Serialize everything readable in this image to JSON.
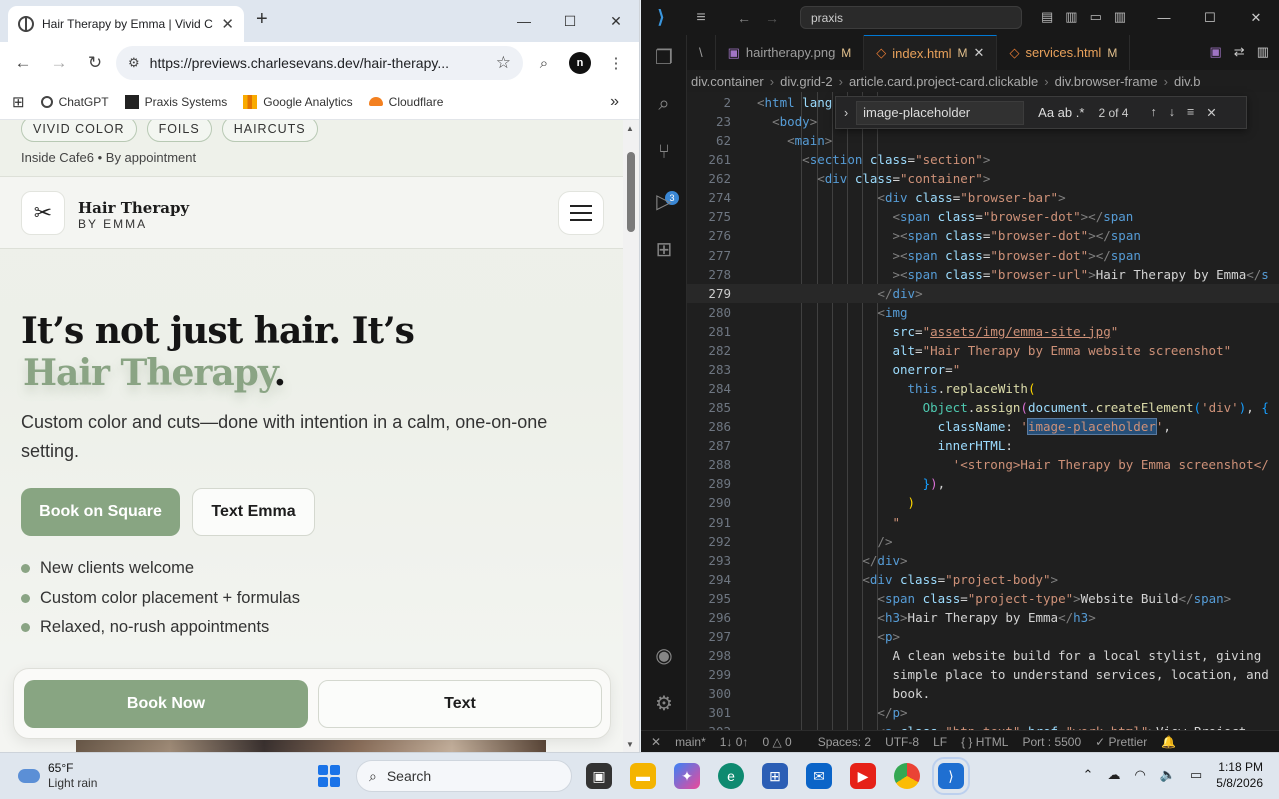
{
  "chrome": {
    "tab_title": "Hair Therapy by Emma | Vivid C",
    "url": "https://previews.charlesevans.dev/hair-therapy...",
    "bookmarks": [
      "ChatGPT",
      "Praxis Systems",
      "Google Analytics",
      "Cloudflare"
    ],
    "profile_initial": "n"
  },
  "site": {
    "chips": [
      "VIVID COLOR",
      "FOILS",
      "HAIRCUTS"
    ],
    "sub_info": "Inside Cafe6 • By appointment",
    "brand_name": "Hair Therapy",
    "brand_sub": "BY EMMA",
    "hero_line1": "It’s not just hair. It’s",
    "hero_line2": "Hair Therapy",
    "hero_dot": ".",
    "hero_desc": "Custom color and cuts—done with intention in a calm, one-on-one setting.",
    "btn_primary": "Book on Square",
    "btn_secondary": "Text Emma",
    "features": [
      "New clients welcome",
      "Custom color placement + formulas",
      "Relaxed, no-rush appointments"
    ],
    "sticky_book": "Book Now",
    "sticky_text": "Text"
  },
  "vscode": {
    "search": "praxis",
    "tabs": [
      {
        "label": "\\",
        "mod": ""
      },
      {
        "label": "hairtherapy.png",
        "mod": "M"
      },
      {
        "label": "index.html",
        "mod": "M"
      },
      {
        "label": "services.html",
        "mod": "M"
      }
    ],
    "breadcrumbs": [
      "div.container",
      "div.grid-2",
      "article.card.project-card.clickable",
      "div.browser-frame",
      "div.b"
    ],
    "find": {
      "query": "image-placeholder",
      "count": "2 of 4"
    },
    "status": {
      "branch": "main*",
      "sync": "1↓ 0↑",
      "problems": "0 △ 0",
      "spaces": "Spaces: 2",
      "encoding": "UTF-8",
      "eol": "LF",
      "language": "{ } HTML",
      "port": "Port : 5500",
      "prettier": "✓ Prettier"
    },
    "lines": [
      {
        "n": "2",
        "html": "<span class='t-brk'>&lt;</span><span class='t-tag'>html</span> <span class='t-attr'>lang</span>"
      },
      {
        "n": "23",
        "html": "  <span class='t-brk'>&lt;</span><span class='t-tag'>body</span><span class='t-brk'>&gt;</span>"
      },
      {
        "n": "62",
        "html": "    <span class='t-brk'>&lt;</span><span class='t-tag'>main</span><span class='t-brk'>&gt;</span>"
      },
      {
        "n": "261",
        "html": "      <span class='t-brk'>&lt;</span><span class='t-tag'>section</span> <span class='t-attr'>class</span><span class='t-txt'>=</span><span class='t-str'>\"section\"</span><span class='t-brk'>&gt;</span>"
      },
      {
        "n": "262",
        "html": "        <span class='t-brk'>&lt;</span><span class='t-tag'>div</span> <span class='t-attr'>class</span><span class='t-txt'>=</span><span class='t-str'>\"container\"</span><span class='t-brk'>&gt;</span>"
      },
      {
        "n": "274",
        "html": "                <span class='t-brk'>&lt;</span><span class='t-tag'>div</span> <span class='t-attr'>class</span><span class='t-txt'>=</span><span class='t-str'>\"browser-bar\"</span><span class='t-brk'>&gt;</span>"
      },
      {
        "n": "275",
        "html": "                  <span class='t-brk'>&lt;</span><span class='t-tag'>span</span> <span class='t-attr'>class</span><span class='t-txt'>=</span><span class='t-str'>\"browser-dot\"</span><span class='t-brk'>&gt;&lt;/</span><span class='t-tag'>span</span>"
      },
      {
        "n": "276",
        "html": "                  <span class='t-brk'>&gt;&lt;</span><span class='t-tag'>span</span> <span class='t-attr'>class</span><span class='t-txt'>=</span><span class='t-str'>\"browser-dot\"</span><span class='t-brk'>&gt;&lt;/</span><span class='t-tag'>span</span>"
      },
      {
        "n": "277",
        "html": "                  <span class='t-brk'>&gt;&lt;</span><span class='t-tag'>span</span> <span class='t-attr'>class</span><span class='t-txt'>=</span><span class='t-str'>\"browser-dot\"</span><span class='t-brk'>&gt;&lt;/</span><span class='t-tag'>span</span>"
      },
      {
        "n": "278",
        "html": "                  <span class='t-brk'>&gt;&lt;</span><span class='t-tag'>span</span> <span class='t-attr'>class</span><span class='t-txt'>=</span><span class='t-str'>\"browser-url\"</span><span class='t-brk'>&gt;</span><span class='t-txt'>Hair Therapy by Emma</span><span class='t-brk'>&lt;/</span><span class='t-tag'>s</span>"
      },
      {
        "n": "279",
        "html": "                <span class='t-brk'>&lt;/</span><span class='t-tag'>div</span><span class='t-brk'>&gt;</span>",
        "current": true
      },
      {
        "n": "280",
        "html": "                <span class='t-brk'>&lt;</span><span class='t-tag'>img</span>"
      },
      {
        "n": "281",
        "html": "                  <span class='t-attr'>src</span><span class='t-txt'>=</span><span class='t-str'>\"<span class='t-link'>assets/img/emma-site.jpg</span>\"</span>"
      },
      {
        "n": "282",
        "html": "                  <span class='t-attr'>alt</span><span class='t-txt'>=</span><span class='t-str'>\"Hair Therapy by Emma website screenshot\"</span>"
      },
      {
        "n": "283",
        "html": "                  <span class='t-attr'>onerror</span><span class='t-txt'>=</span><span class='t-str'>\"</span>"
      },
      {
        "n": "284",
        "html": "                    <span class='t-kw'>this</span><span class='t-txt'>.</span><span class='t-fn'>replaceWith</span><span class='t-p1'>(</span>"
      },
      {
        "n": "285",
        "html": "                      <span class='t-ent'>Object</span><span class='t-txt'>.</span><span class='t-fn'>assign</span><span class='t-p2'>(</span><span class='t-attr'>document</span><span class='t-txt'>.</span><span class='t-fn'>createElement</span><span class='t-p3'>(</span><span class='t-str'>'div'</span><span class='t-p3'>)</span><span class='t-txt'>, </span><span class='t-p3'>{</span>"
      },
      {
        "n": "286",
        "html": "                        <span class='t-attr'>className</span><span class='t-txt'>: </span><span class='t-str'>'<span class='t-hl'>image-placeholder</span>'</span><span class='t-txt'>,</span>"
      },
      {
        "n": "287",
        "html": "                        <span class='t-attr'>innerHTML</span><span class='t-txt'>:</span>"
      },
      {
        "n": "288",
        "html": "                          <span class='t-str'>'&lt;strong&gt;Hair Therapy by Emma screenshot&lt;/</span>"
      },
      {
        "n": "289",
        "html": "                      <span class='t-p3'>}</span><span class='t-p2'>)</span><span class='t-txt'>,</span>"
      },
      {
        "n": "290",
        "html": "                    <span class='t-p1'>)</span>"
      },
      {
        "n": "291",
        "html": "                  <span class='t-str'>\"</span>"
      },
      {
        "n": "292",
        "html": "                <span class='t-brk'>/&gt;</span>"
      },
      {
        "n": "293",
        "html": "              <span class='t-brk'>&lt;/</span><span class='t-tag'>div</span><span class='t-brk'>&gt;</span>"
      },
      {
        "n": "294",
        "html": "              <span class='t-brk'>&lt;</span><span class='t-tag'>div</span> <span class='t-attr'>class</span><span class='t-txt'>=</span><span class='t-str'>\"project-body\"</span><span class='t-brk'>&gt;</span>"
      },
      {
        "n": "295",
        "html": "                <span class='t-brk'>&lt;</span><span class='t-tag'>span</span> <span class='t-attr'>class</span><span class='t-txt'>=</span><span class='t-str'>\"project-type\"</span><span class='t-brk'>&gt;</span><span class='t-txt'>Website Build</span><span class='t-brk'>&lt;/</span><span class='t-tag'>span</span><span class='t-brk'>&gt;</span>"
      },
      {
        "n": "296",
        "html": "                <span class='t-brk'>&lt;</span><span class='t-tag'>h3</span><span class='t-brk'>&gt;</span><span class='t-txt'>Hair Therapy by Emma</span><span class='t-brk'>&lt;/</span><span class='t-tag'>h3</span><span class='t-brk'>&gt;</span>"
      },
      {
        "n": "297",
        "html": "                <span class='t-brk'>&lt;</span><span class='t-tag'>p</span><span class='t-brk'>&gt;</span>"
      },
      {
        "n": "298",
        "html": "                  <span class='t-txt'>A clean website build for a local stylist, giving</span>"
      },
      {
        "n": "299",
        "html": "                  <span class='t-txt'>simple place to understand services, location, and</span>"
      },
      {
        "n": "300",
        "html": "                  <span class='t-txt'>book.</span>"
      },
      {
        "n": "301",
        "html": "                <span class='t-brk'>&lt;/</span><span class='t-tag'>p</span><span class='t-brk'>&gt;</span>"
      },
      {
        "n": "302",
        "html": "                <span class='t-brk'>&lt;</span><span class='t-tag'>a</span> <span class='t-attr'>class</span><span class='t-txt'>=</span><span class='t-str'>\"btn-text\"</span> <span class='t-attr'>href</span><span class='t-txt'>=</span><span class='t-str'>\"work.html\"</span><span class='t-brk'>&gt;</span><span class='t-txt'>View Project</span>"
      }
    ]
  },
  "taskbar": {
    "temp": "65°F",
    "condition": "Light rain",
    "search_label": "Search",
    "time": "1:18 PM",
    "date": "5/8/2026"
  }
}
